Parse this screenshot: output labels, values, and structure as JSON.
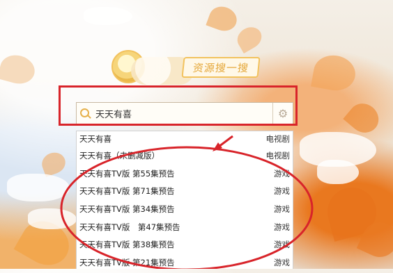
{
  "logo": {
    "text": "资源搜一搜"
  },
  "search": {
    "value": "天天有喜"
  },
  "dropdown": {
    "items": [
      {
        "title": "天天有喜",
        "category": "电视剧"
      },
      {
        "title": "天天有喜（未删减版）",
        "category": "电视剧"
      },
      {
        "title": "天天有喜TV版 第55集预告",
        "category": "游戏"
      },
      {
        "title": "天天有喜TV版 第71集预告",
        "category": "游戏"
      },
      {
        "title": "天天有喜TV版 第34集预告",
        "category": "游戏"
      },
      {
        "title": "天天有喜TV版　第47集预告",
        "category": "游戏"
      },
      {
        "title": "天天有喜TV版 第38集预告",
        "category": "游戏"
      },
      {
        "title": "天天有喜TV版 第21集预告",
        "category": "游戏"
      }
    ]
  },
  "icons": {
    "search": "search-icon",
    "settings": "gear-icon"
  },
  "colors": {
    "annotation": "#d8242a",
    "accent": "#e6b04a"
  }
}
